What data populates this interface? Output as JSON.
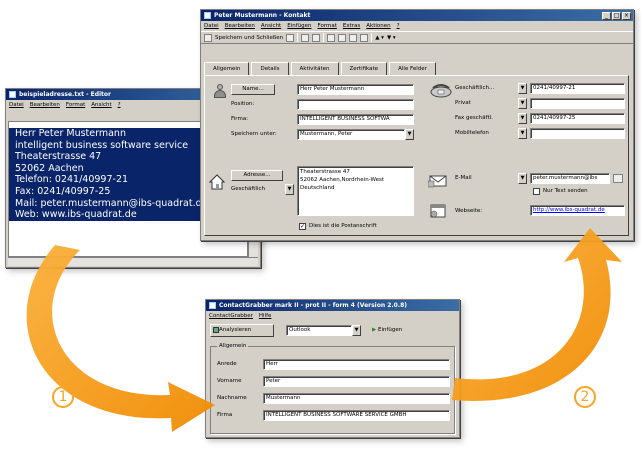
{
  "editor": {
    "title": "beispieladresse.txt - Editor",
    "menu": [
      "Datei",
      "Bearbeiten",
      "Format",
      "Ansicht",
      "?"
    ],
    "lines": [
      "Herr Peter Mustermann",
      "intelligent business software service",
      "Theaterstrasse 47",
      "52062 Aachen",
      "Telefon: 0241/40997-21",
      "Fax: 0241/40997-25",
      "Mail: peter.mustermann@ibs-quadrat.de",
      "Web: www.ibs-quadrat.de"
    ]
  },
  "contact": {
    "title": "Peter Mustermann - Kontakt",
    "menu": [
      "Datei",
      "Bearbeiten",
      "Ansicht",
      "Einfügen",
      "Format",
      "Extras",
      "Aktionen",
      "?"
    ],
    "toolbar": {
      "save_close": "Speichern und Schließen"
    },
    "tabs": [
      "Allgemein",
      "Details",
      "Aktivitäten",
      "Zertifikate",
      "Alle Felder"
    ],
    "name_button": "Name...",
    "name_value": "Herr Peter Mustermann",
    "position_label": "Position:",
    "firma_label": "Firma:",
    "firma_value": "INTELLIGENT BUSINESS SOFTWA",
    "speichern_label": "Speichern unter:",
    "speichern_value": "Mustermann, Peter",
    "address_button": "Adresse...",
    "address_type": "Geschäftlich",
    "address_lines": [
      "Theaterstrasse 47",
      "52062 Aachen,Nordrhein-West",
      "Deutschland"
    ],
    "postal_label": "Dies ist die Postanschrift",
    "phone_labels": [
      "Geschäftlich...",
      "Privat",
      "Fax geschäftl.",
      "Mobiltelefon"
    ],
    "phone_values": [
      "0241/40997-21",
      "",
      "0241/40997-25",
      ""
    ],
    "email_label": "E-Mail",
    "email_value": "peter.mustermann@ibs",
    "nur_text": "Nur Text senden",
    "web_label": "Webseite:",
    "web_value": "http://www.ibs-quadrat.de"
  },
  "grabber": {
    "title": "ContactGrabber mark II - prot II - form 4 (Version 2.0.8)",
    "menu": [
      "ContactGrabber",
      "Hilfe"
    ],
    "toolbar": {
      "analyze": "Analysieren",
      "target": "Outlook",
      "insert": "Einfügen"
    },
    "group_label": "Allgemein",
    "fields": [
      {
        "label": "Anrede",
        "value": "Herr"
      },
      {
        "label": "Vorname",
        "value": "Peter"
      },
      {
        "label": "Nachname",
        "value": "Mustermann"
      },
      {
        "label": "Firma",
        "value": "INTELLIGENT BUSINESS SOFTWARE SERVICE GMBH"
      }
    ]
  },
  "callouts": [
    "1",
    "2"
  ],
  "colors": {
    "arrow": "#f5a623",
    "selection": "#0a246a",
    "link": "#0000ff"
  }
}
